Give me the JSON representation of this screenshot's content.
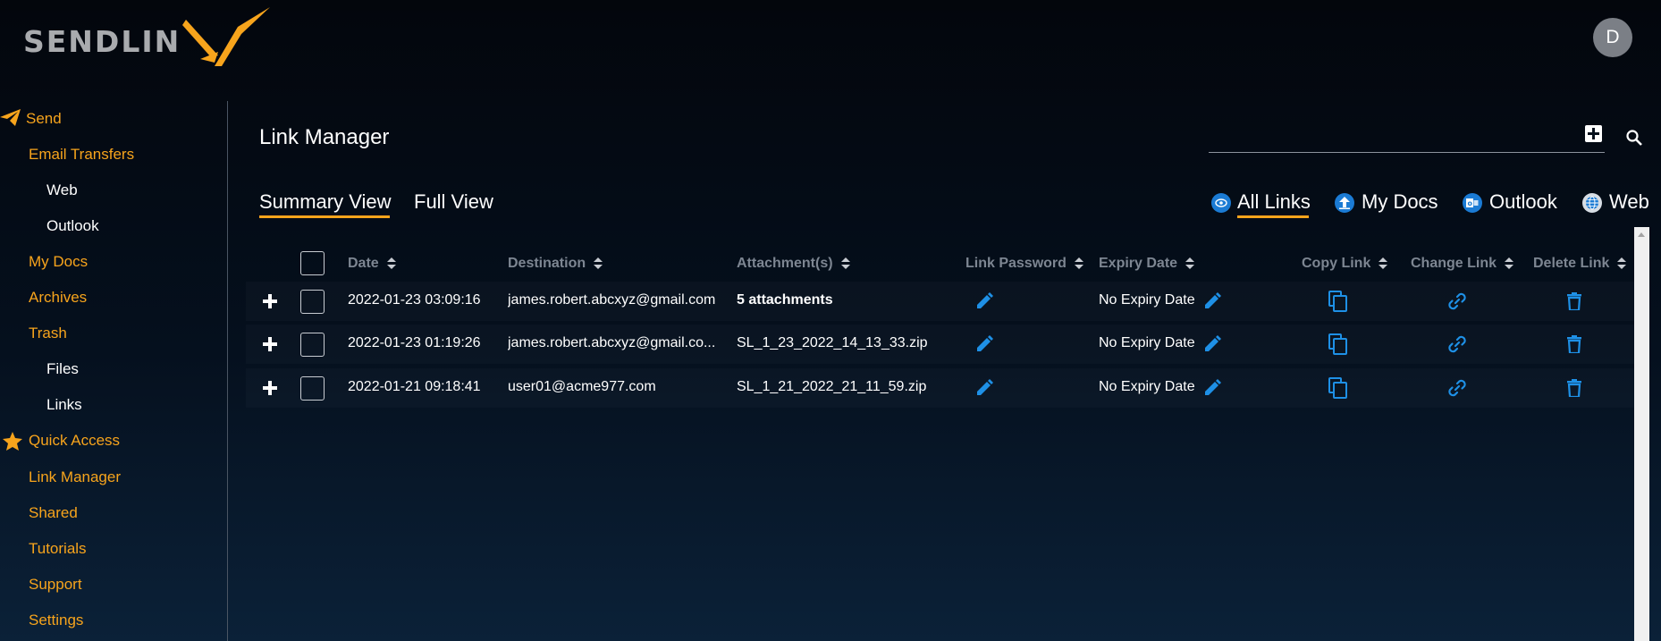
{
  "logo": {
    "text": "SENDLIN"
  },
  "user": {
    "avatar_initial": "D"
  },
  "sidebar": {
    "send": "Send",
    "email_transfers": "Email Transfers",
    "web": "Web",
    "outlook": "Outlook",
    "my_docs": "My Docs",
    "archives": "Archives",
    "trash": "Trash",
    "files": "Files",
    "links": "Links",
    "quick_access": "Quick Access",
    "link_manager": "Link Manager",
    "shared": "Shared",
    "tutorials": "Tutorials",
    "support": "Support",
    "settings": "Settings"
  },
  "main": {
    "title": "Link Manager",
    "view_tabs": {
      "summary": "Summary View",
      "full": "Full View"
    },
    "filter_tabs": {
      "all_links": "All Links",
      "my_docs": "My Docs",
      "outlook": "Outlook",
      "web": "Web"
    }
  },
  "table": {
    "headers": {
      "date": "Date",
      "destination": "Destination",
      "attachments": "Attachment(s)",
      "link_password": "Link Password",
      "expiry_date": "Expiry Date",
      "copy_link": "Copy Link",
      "change_link": "Change Link",
      "delete_link": "Delete Link"
    },
    "rows": [
      {
        "date": "2022-01-23 03:09:16",
        "destination": "james.robert.abcxyz@gmail.com",
        "attachment": "5 attachments",
        "expiry": "No Expiry Date"
      },
      {
        "date": "2022-01-23 01:19:26",
        "destination": "james.robert.abcxyz@gmail.co...",
        "attachment": "SL_1_23_2022_14_13_33.zip",
        "expiry": "No Expiry Date"
      },
      {
        "date": "2022-01-21 09:18:41",
        "destination": "user01@acme977.com",
        "attachment": "SL_1_21_2022_21_11_59.zip",
        "expiry": "No Expiry Date"
      }
    ]
  },
  "colors": {
    "accent": "#f7a41c",
    "action_blue": "#1e90e6",
    "header_gray": "#7d8692"
  }
}
